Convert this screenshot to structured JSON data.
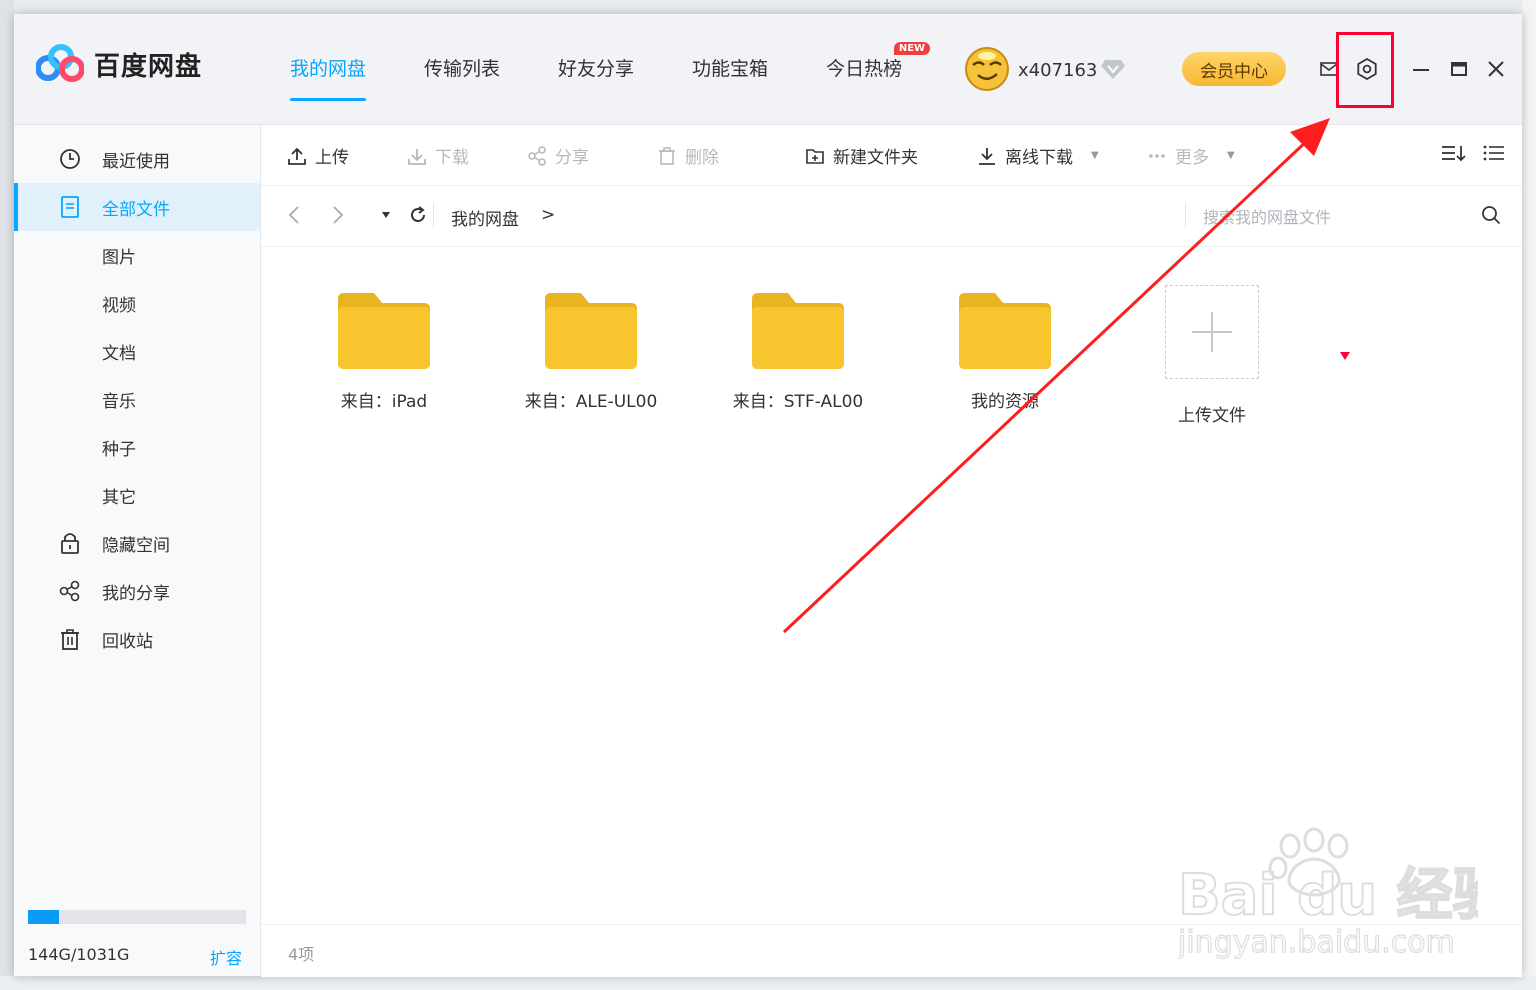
{
  "app": {
    "title": "百度网盘"
  },
  "header": {
    "nav": [
      {
        "label": "我的网盘",
        "active": true
      },
      {
        "label": "传输列表"
      },
      {
        "label": "好友分享"
      },
      {
        "label": "功能宝箱"
      },
      {
        "label": "今日热榜",
        "badge": "NEW"
      }
    ],
    "username": "x407163",
    "vip_label": "会员中心",
    "icons": [
      "mail-icon",
      "settings-icon",
      "minimize-icon",
      "maximize-icon",
      "close-icon"
    ]
  },
  "sidebar": {
    "items": [
      {
        "label": "最近使用",
        "icon": "clock-icon"
      },
      {
        "label": "全部文件",
        "icon": "file-icon",
        "active": true
      },
      {
        "label": "图片"
      },
      {
        "label": "视频"
      },
      {
        "label": "文档"
      },
      {
        "label": "音乐"
      },
      {
        "label": "种子"
      },
      {
        "label": "其它"
      },
      {
        "label": "隐藏空间",
        "icon": "lock-icon"
      },
      {
        "label": "我的分享",
        "icon": "share-icon"
      },
      {
        "label": "回收站",
        "icon": "trash-icon"
      }
    ],
    "quota": {
      "text": "144G/1031G",
      "used_fraction": 0.14,
      "expand_label": "扩容"
    }
  },
  "toolbar": {
    "upload": "上传",
    "download": "下载",
    "share": "分享",
    "delete": "删除",
    "new_folder": "新建文件夹",
    "offline_download": "离线下载",
    "more": "更多"
  },
  "address": {
    "breadcrumb": "我的网盘",
    "separator": ">",
    "search_placeholder": "搜索我的网盘文件"
  },
  "files": [
    {
      "name": "来自：iPad",
      "type": "folder"
    },
    {
      "name": "来自：ALE-UL00",
      "type": "folder"
    },
    {
      "name": "来自：STF-AL00",
      "type": "folder"
    },
    {
      "name": "我的资源",
      "type": "folder"
    },
    {
      "name": "上传文件",
      "type": "upload"
    }
  ],
  "status": {
    "count": "4项"
  },
  "colors": {
    "accent": "#06a7ff",
    "folder": "#f7c62f",
    "annotation": "#ff1e1e"
  }
}
